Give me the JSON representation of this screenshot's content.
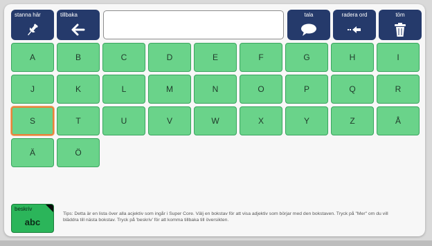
{
  "toolbar": {
    "stay_label": "stanna här",
    "back_label": "tillbaka",
    "speak_label": "tala",
    "delete_word_label": "radera ord",
    "clear_label": "töm"
  },
  "message_box": {
    "value": ""
  },
  "letters": [
    "A",
    "B",
    "C",
    "D",
    "E",
    "F",
    "G",
    "H",
    "I",
    "J",
    "K",
    "L",
    "M",
    "N",
    "O",
    "P",
    "Q",
    "R",
    "S",
    "T",
    "U",
    "V",
    "W",
    "X",
    "Y",
    "Z",
    "Å",
    "Ä",
    "Ö"
  ],
  "selected_letter": "S",
  "describe_button": {
    "label": "beskriv",
    "sub_label": "abc"
  },
  "tips": "Tips: Detta är en lista över alla acjektiv som ingår i Super Core. Välj en bokstav för att visa adjektiv som börjar med den bokstaven. Tryck på \"Mer\" om du vill bläddra till nästa bokstav. Tryck på 'beskriv' för att komma tillbaka till översikten.",
  "colors": {
    "toolbar": "#253a6b",
    "key": "#6ad38a",
    "selected_outline": "#e7833a",
    "describe": "#2bb55a"
  }
}
